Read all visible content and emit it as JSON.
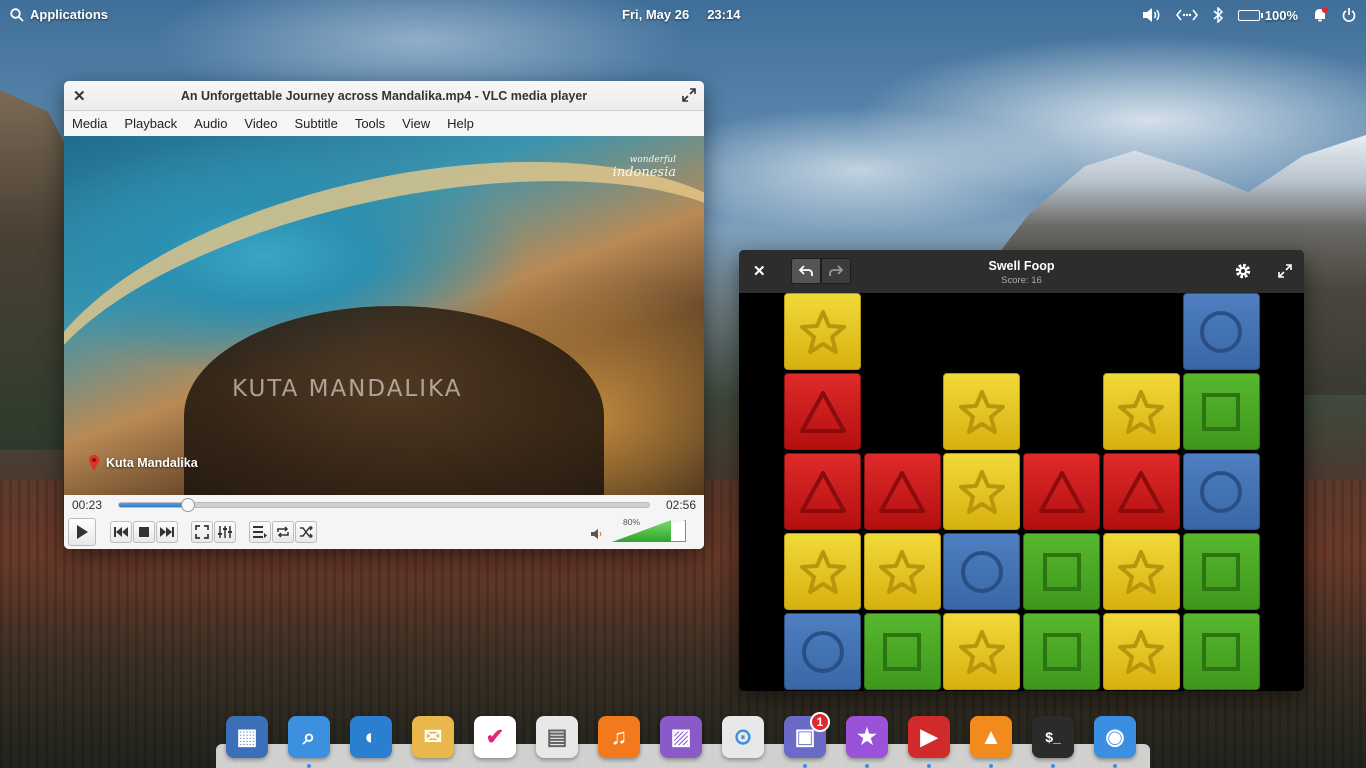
{
  "panel": {
    "applications_label": "Applications",
    "date": "Fri, May 26",
    "time": "23:14",
    "battery_percent": "100%",
    "battery_level": 1.0
  },
  "vlc": {
    "title": "An Unforgettable Journey across Mandalika.mp4 - VLC media player",
    "menu": [
      "Media",
      "Playback",
      "Audio",
      "Video",
      "Subtitle",
      "Tools",
      "View",
      "Help"
    ],
    "video": {
      "brand_line1": "wonderful",
      "brand_line2": "indonesia",
      "caption": "KUTA  MANDALIKA",
      "location": "Kuta Mandalika"
    },
    "elapsed": "00:23",
    "duration": "02:56",
    "progress_fraction": 0.13,
    "volume_label": "80%",
    "volume_fraction": 0.8
  },
  "swell": {
    "title": "Swell Foop",
    "score_text": "Score: 16",
    "grid": [
      [
        "yellow-star",
        "",
        "",
        "",
        "",
        "blue-circle"
      ],
      [
        "red-triangle",
        "",
        "yellow-star",
        "",
        "yellow-star",
        "green-square"
      ],
      [
        "red-triangle",
        "red-triangle",
        "yellow-star",
        "red-triangle",
        "red-triangle",
        "blue-circle"
      ],
      [
        "yellow-star",
        "yellow-star",
        "blue-circle",
        "green-square",
        "yellow-star",
        "green-square"
      ],
      [
        "blue-circle",
        "green-square",
        "yellow-star",
        "green-square",
        "yellow-star",
        "green-square"
      ]
    ]
  },
  "dock": {
    "apps": [
      {
        "name": "multitasking-view",
        "color": "#3b6fb8",
        "running": false
      },
      {
        "name": "files",
        "color": "#3d8fe0",
        "running": true
      },
      {
        "name": "web-browser",
        "color": "#2a7fd0",
        "running": false
      },
      {
        "name": "mail",
        "color": "#e8b84a",
        "running": false
      },
      {
        "name": "tasks",
        "color": "#ffffff",
        "running": false
      },
      {
        "name": "calendar",
        "color": "#e8e8e8",
        "running": false
      },
      {
        "name": "music",
        "color": "#f27a1c",
        "running": false
      },
      {
        "name": "photos",
        "color": "#8a5bc8",
        "running": false
      },
      {
        "name": "settings",
        "color": "#e8e8e8",
        "running": false
      },
      {
        "name": "appcenter",
        "color": "#6a6ac8",
        "running": true,
        "badge": "1"
      },
      {
        "name": "favorites",
        "color": "#9a52d8",
        "running": true
      },
      {
        "name": "videos",
        "color": "#d02a2a",
        "running": true
      },
      {
        "name": "vlc",
        "color": "#f28a1c",
        "running": true
      },
      {
        "name": "terminal",
        "color": "#2b2b2b",
        "running": true
      },
      {
        "name": "swell-foop",
        "color": "#3b8fe0",
        "running": true
      }
    ]
  }
}
